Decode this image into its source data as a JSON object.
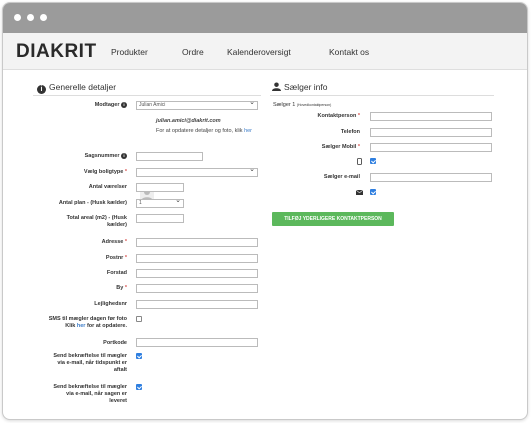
{
  "brand": {
    "logo": "DIAKRIT"
  },
  "nav": {
    "items": [
      "Produkter",
      "Ordre",
      "Kalenderoversigt",
      "Kontakt os"
    ]
  },
  "left_section": {
    "title": "Generelle detaljer",
    "modtager_label": "Modtager",
    "modtager_value": "Julian Amici",
    "user_email": "julian.amici@diakrit.com",
    "user_note_1": "For at opdatere detaljer og foto, klik",
    "user_note_link": "her",
    "sagsnummer_label": "Sagsnummer",
    "boligtype_label": "Vælg boligtype",
    "vaerelser_label": "Antal værelser",
    "plan_label": "Antal plan - (Husk kælder)",
    "plan_value": "1",
    "areal_label_1": "Total areal (m2) - (Husk",
    "areal_label_2": "kælder)",
    "adresse_label": "Adresse",
    "postnr_label": "Postnr",
    "forstad_label": "Forstad",
    "by_label": "By",
    "lejlighed_label": "Lejlighedsnr",
    "sms_label_1": "SMS til mægler dagen før foto",
    "sms_label_2a": "Klik ",
    "sms_label_link": "her",
    "sms_label_2b": " for at opdatere.",
    "portkode_label": "Portkode",
    "send1_label_1": "Send bekræftelse til mægler",
    "send1_label_2": "via e-mail, når tidspunkt er",
    "send1_label_3": "aftalt",
    "send2_label_1": "Send bekræftelse til mægler",
    "send2_label_2": "via e-mail, når sagen er",
    "send2_label_3": "leveret"
  },
  "right_section": {
    "title": "Sælger info",
    "seller_heading": "Sælger 1",
    "seller_heading_note": "(Hovedkontaktperson)",
    "kontakt_label": "Kontaktperson",
    "telefon_label": "Telefon",
    "mobil_label": "Sælger Mobil",
    "email_label": "Sælger e-mail",
    "add_button": "TILFØJ YDERLIGERE KONTAKTPERSON"
  },
  "colors": {
    "accent": "#2f7fe0",
    "button_green": "#5cb85c",
    "required": "#d9534f",
    "titlebar": "#9b9b9b"
  },
  "icons": [
    "info-icon",
    "user-icon",
    "mobile-icon",
    "envelope-icon",
    "chevron-down-icon"
  ]
}
